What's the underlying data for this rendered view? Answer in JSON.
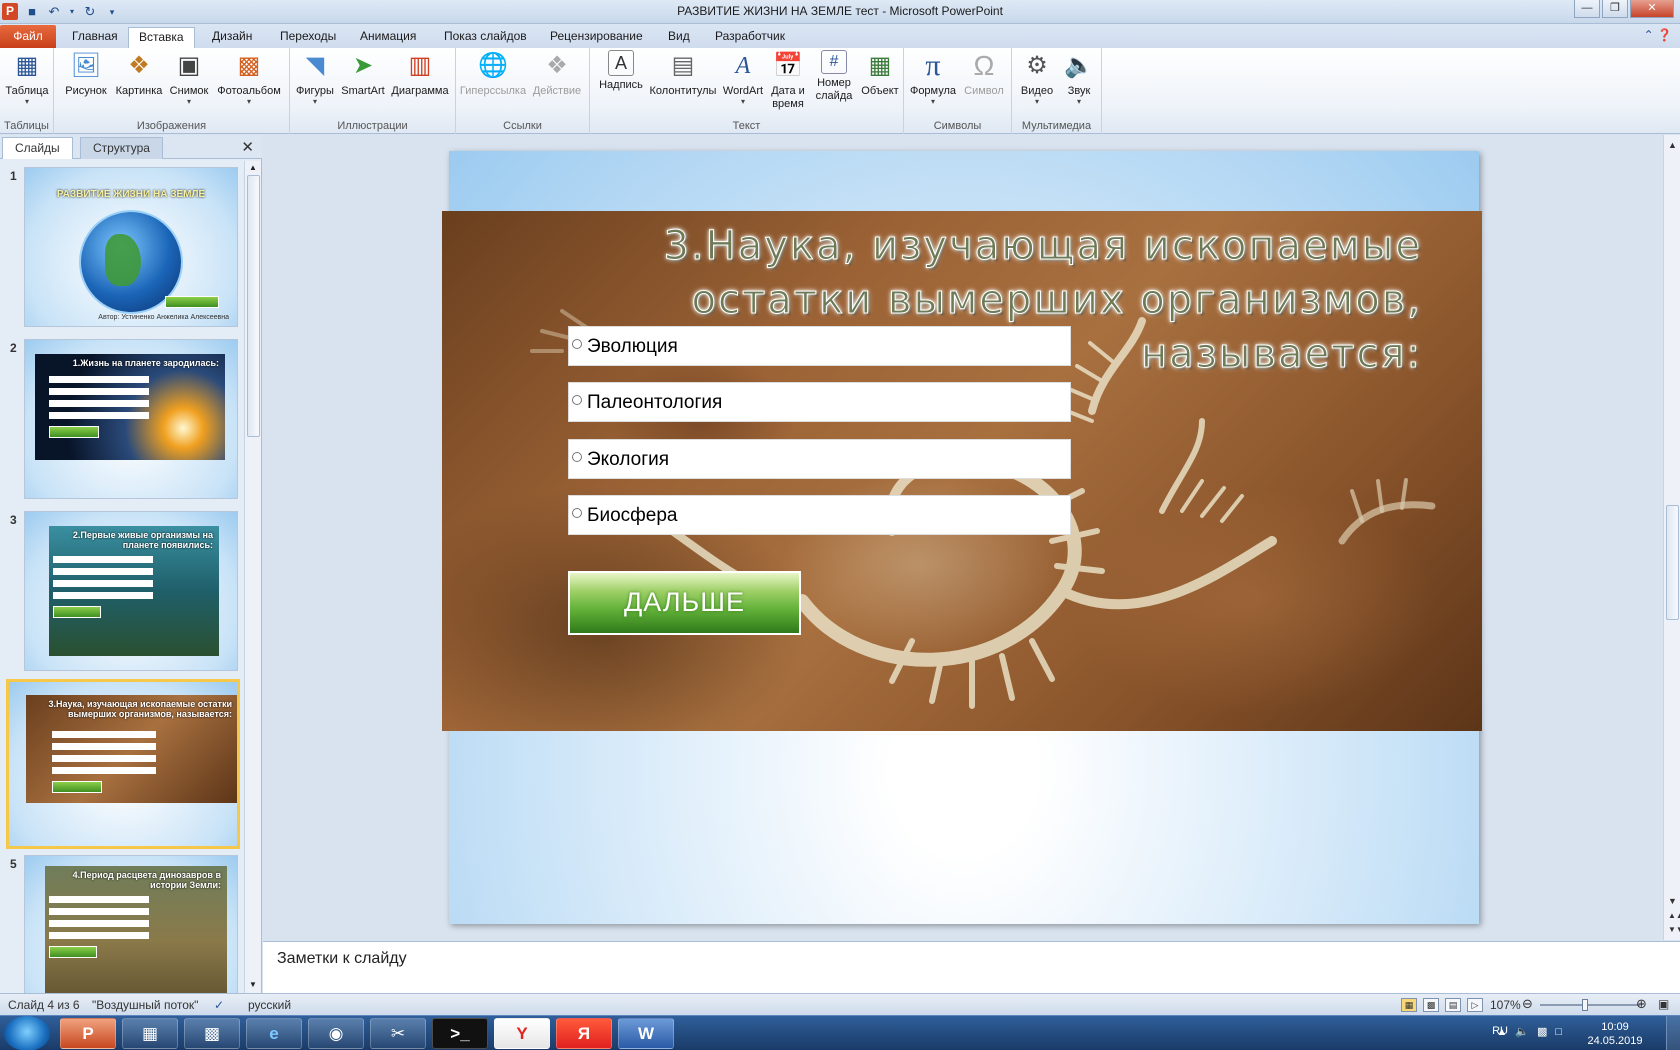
{
  "window": {
    "title": "РАЗВИТИЕ ЖИЗНИ НА ЗЕМЛЕ тест  -  Microsoft PowerPoint",
    "app_icon": "P",
    "controls": [
      "minimize-icon",
      "maximize-icon",
      "close-icon"
    ]
  },
  "ribbon_tabs": {
    "file": "Файл",
    "home": "Главная",
    "insert": "Вставка",
    "design": "Дизайн",
    "transitions": "Переходы",
    "animation": "Анимация",
    "slideshow": "Показ слайдов",
    "review": "Рецензирование",
    "view": "Вид",
    "developer": "Разработчик"
  },
  "ribbon": {
    "groups": {
      "tables": "Таблицы",
      "images": "Изображения",
      "illustrations": "Иллюстрации",
      "links": "Ссылки",
      "text": "Текст",
      "symbols": "Символы",
      "multimedia": "Мультимедиа"
    },
    "buttons": {
      "table": "Таблица",
      "picture": "Рисунок",
      "clipart": "Картинка",
      "screenshot": "Снимок",
      "photoalbum": "Фотоальбом",
      "shapes": "Фигуры",
      "smartart": "SmartArt",
      "chart": "Диаграмма",
      "hyperlink": "Гиперссылка",
      "action": "Действие",
      "textbox": "Надпись",
      "headerfooter": "Колонтитулы",
      "wordart": "WordArt",
      "datetime_1": "Дата и",
      "datetime_2": "время",
      "slidenum_1": "Номер",
      "slidenum_2": "слайда",
      "object": "Объект",
      "formula": "Формула",
      "symbol": "Символ",
      "video": "Видео",
      "audio": "Звук"
    }
  },
  "left_panel": {
    "tab_slides": "Слайды",
    "tab_outline": "Структура",
    "thumbnails": [
      {
        "num": "1",
        "title": "РАЗВИТИЕ ЖИЗНИ НА ЗЕМЛЕ",
        "author": "Автор: Устиненко Анжелика Алексеевна"
      },
      {
        "num": "2",
        "title": "1.Жизнь на планете зародилась:"
      },
      {
        "num": "3",
        "title": "2.Первые живые организмы на планете появились:"
      },
      {
        "num": "4",
        "title": "3.Наука, изучающая ископаемые остатки вымерших организмов, называется:"
      },
      {
        "num": "5",
        "title": "4.Период расцвета динозавров в истории Земли:"
      }
    ]
  },
  "slide": {
    "question": "3.Наука, изучающая ископаемые остатки вымерших организмов, называется:",
    "options": [
      "Эволюция",
      "Палеонтология",
      "Экология",
      "Биосфера"
    ],
    "next_button": "ДАЛЬШЕ"
  },
  "notes": {
    "placeholder": "Заметки к слайду"
  },
  "status": {
    "slide_of": "Слайд 4 из 6",
    "theme": "\"Воздушный поток\"",
    "language": "русский",
    "zoom": "107%"
  },
  "taskbar": {
    "tray_lang": "RU",
    "time": "10:09",
    "date": "24.05.2019"
  }
}
